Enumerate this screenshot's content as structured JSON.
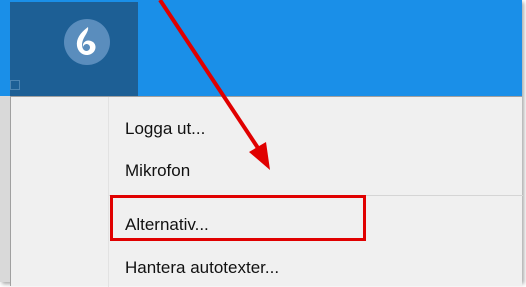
{
  "menu": {
    "items": [
      {
        "label": "Logga ut..."
      },
      {
        "label": "Mikrofon"
      },
      {
        "label": "Alternativ..."
      },
      {
        "label": "Hantera autotexter..."
      }
    ]
  },
  "colors": {
    "taskbar": "#1a8fe8",
    "app_tile": "#1d5f95",
    "annotation": "#e00000",
    "menu_background": "#f0f0f0"
  },
  "icons": {
    "app_logo": "dragon-logo-icon"
  },
  "annotation": {
    "target": "Alternativ..."
  }
}
